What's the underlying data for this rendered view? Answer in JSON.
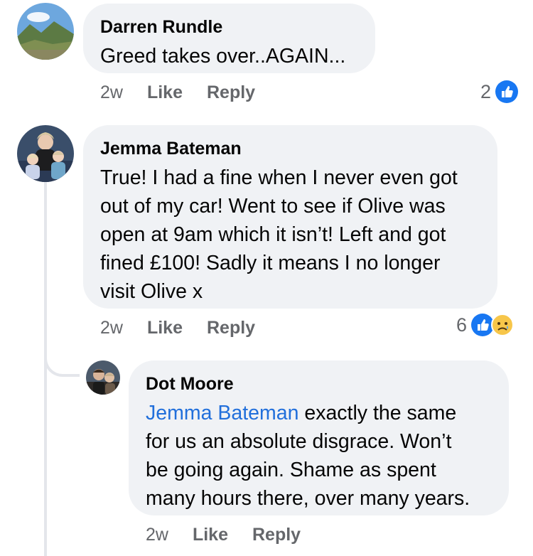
{
  "comments": [
    {
      "author": "Darren Rundle",
      "text": "Greed takes over..AGAIN...",
      "time": "2w",
      "like_label": "Like",
      "reply_label": "Reply",
      "reaction_count": "2",
      "reactions": [
        "like-icon"
      ]
    },
    {
      "author": "Jemma Bateman",
      "text_lines": [
        "True! I had a fine when I never even got",
        "out of my car! Went to see if Olive was",
        "open at 9am which it isn’t! Left and got",
        "fined £100! Sadly it means I no longer",
        "visit Olive x"
      ],
      "time": "2w",
      "like_label": "Like",
      "reply_label": "Reply",
      "reaction_count": "6",
      "reactions": [
        "like-icon",
        "sad-icon"
      ]
    },
    {
      "author": "Dot Moore",
      "mention": "Jemma Bateman",
      "first_line_rest": " exactly the same",
      "text_lines": [
        "for us an absolute disgrace. Won’t",
        "be going again. Shame as spent",
        "many hours there, over many years."
      ],
      "time": "2w",
      "like_label": "Like",
      "reply_label": "Reply"
    }
  ],
  "colors": {
    "bubble": "#f0f2f5",
    "meta": "#65676b",
    "link": "#216fdb",
    "like_blue": "#1877f2"
  }
}
